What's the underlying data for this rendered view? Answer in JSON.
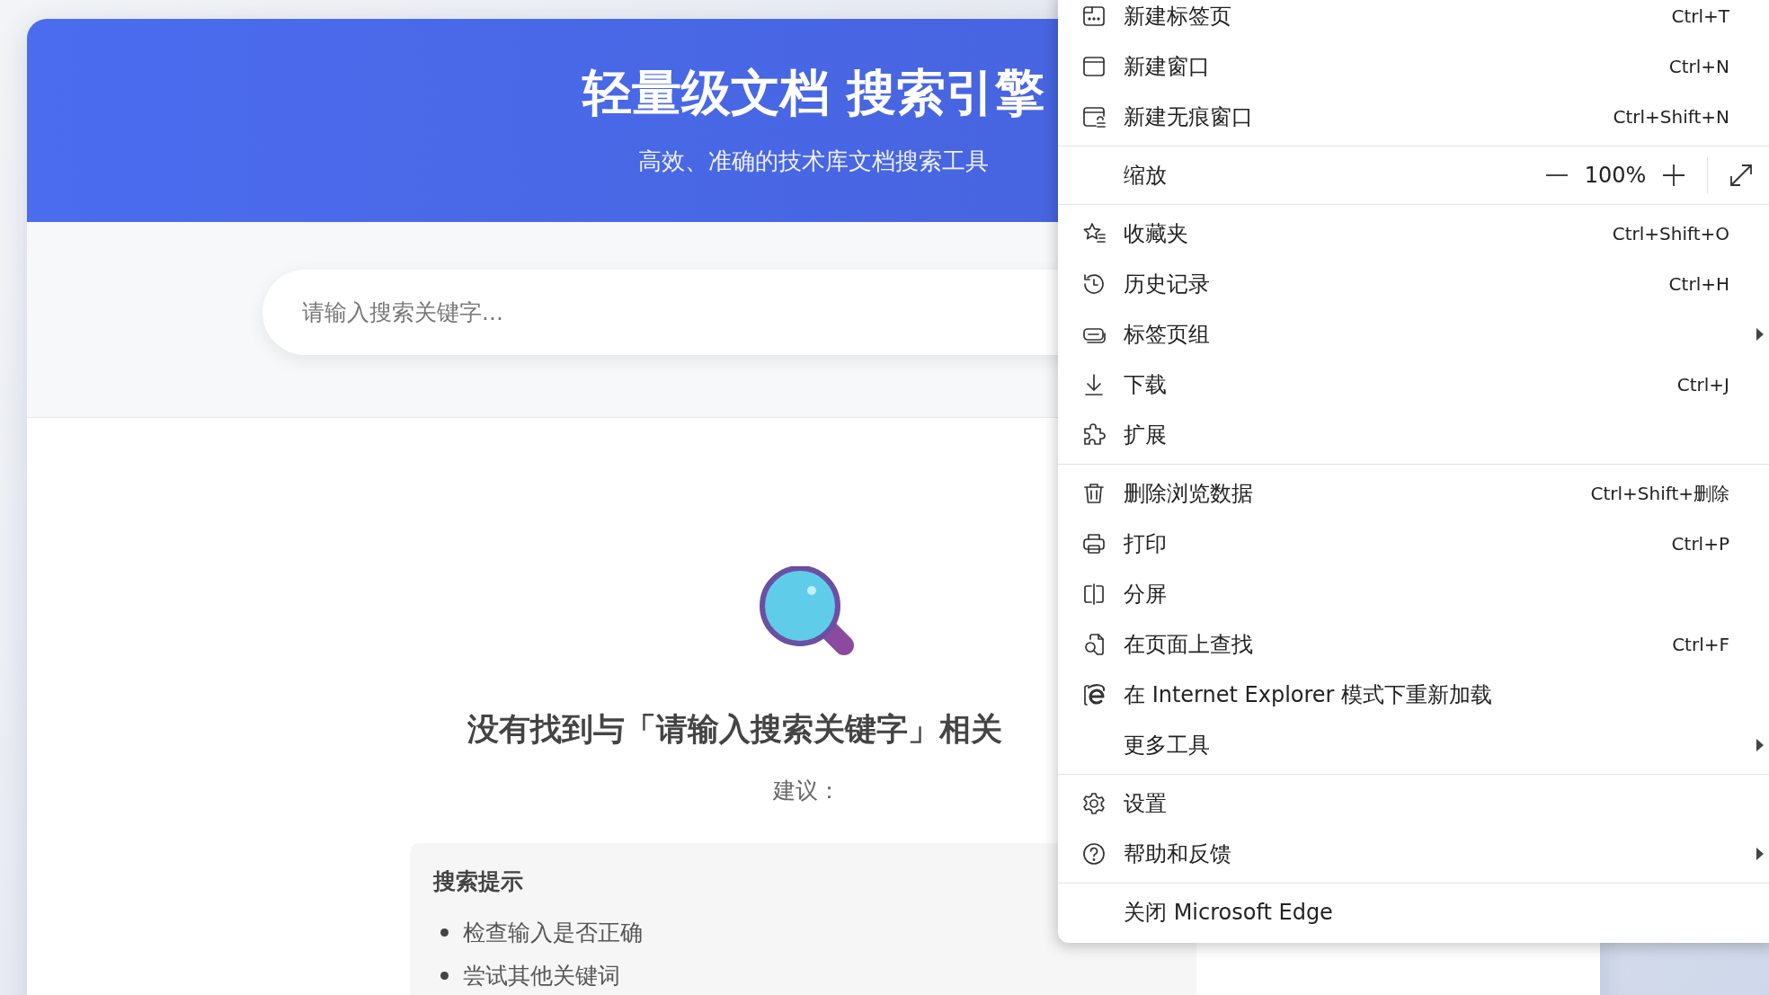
{
  "header": {
    "title": "轻量级文档 搜索引擎",
    "subtitle": "高效、准确的技术库文档搜索工具"
  },
  "search": {
    "placeholder": "请输入搜索关键字..."
  },
  "empty_state": {
    "message": "没有找到与「请输入搜索关键字」相关",
    "suggestion_label": "建议：",
    "tips": {
      "title": "搜索提示",
      "items": [
        "检查输入是否正确",
        "尝试其他关键词"
      ]
    }
  },
  "menu": {
    "groups": [
      [
        {
          "kind": "item",
          "label": "新建标签页",
          "shortcut": "Ctrl+T",
          "submenu": false
        },
        {
          "kind": "item",
          "label": "新建窗口",
          "shortcut": "Ctrl+N",
          "submenu": false
        },
        {
          "kind": "item",
          "label": "新建无痕窗口",
          "shortcut": "Ctrl+Shift+N",
          "submenu": false
        }
      ],
      [
        {
          "kind": "zoom",
          "label": "缩放",
          "value": "100%"
        }
      ],
      [
        {
          "kind": "item",
          "label": "收藏夹",
          "shortcut": "Ctrl+Shift+O",
          "submenu": false
        },
        {
          "kind": "item",
          "label": "历史记录",
          "shortcut": "Ctrl+H",
          "submenu": false
        },
        {
          "kind": "item",
          "label": "标签页组",
          "submenu": true
        },
        {
          "kind": "item",
          "label": "下载",
          "shortcut": "Ctrl+J",
          "submenu": false
        },
        {
          "kind": "item",
          "label": "扩展",
          "submenu": false
        }
      ],
      [
        {
          "kind": "item",
          "label": "删除浏览数据",
          "shortcut": "Ctrl+Shift+删除",
          "submenu": false
        },
        {
          "kind": "item",
          "label": "打印",
          "shortcut": "Ctrl+P",
          "submenu": false
        },
        {
          "kind": "item",
          "label": "分屏",
          "submenu": false
        },
        {
          "kind": "item",
          "label": "在页面上查找",
          "shortcut": "Ctrl+F",
          "submenu": false
        },
        {
          "kind": "item",
          "label": "在 Internet Explorer 模式下重新加载",
          "submenu": false
        },
        {
          "kind": "item",
          "label": "更多工具",
          "submenu": true
        }
      ],
      [
        {
          "kind": "item",
          "label": "设置",
          "submenu": false
        },
        {
          "kind": "item",
          "label": "帮助和反馈",
          "submenu": true
        }
      ],
      [
        {
          "kind": "item",
          "label": "关闭 Microsoft Edge",
          "submenu": false
        }
      ]
    ]
  }
}
